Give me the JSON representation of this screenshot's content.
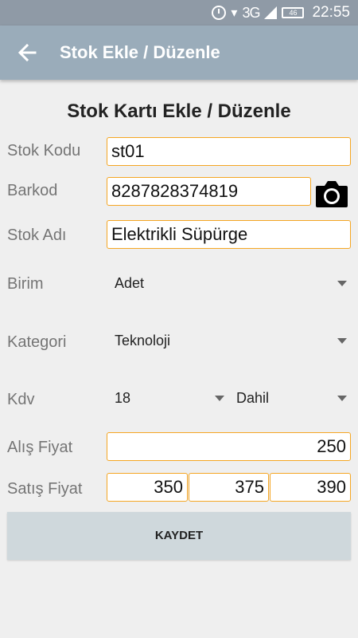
{
  "status_bar": {
    "network": "3G",
    "battery": "46",
    "time": "22:55"
  },
  "app_bar": {
    "title": "Stok Ekle / Düzenle"
  },
  "form": {
    "title": "Stok Kartı Ekle / Düzenle",
    "stok_kodu": {
      "label": "Stok Kodu",
      "value": "st01"
    },
    "barkod": {
      "label": "Barkod",
      "value": "8287828374819"
    },
    "stok_adi": {
      "label": "Stok Adı",
      "value": "Elektrikli Süpürge"
    },
    "birim": {
      "label": "Birim",
      "value": "Adet"
    },
    "kategori": {
      "label": "Kategori",
      "value": "Teknoloji"
    },
    "kdv": {
      "label": "Kdv",
      "rate": "18",
      "mode": "Dahil"
    },
    "alis_fiyat": {
      "label": "Alış Fiyat",
      "value": "250"
    },
    "satis_fiyat": {
      "label": "Satış Fiyat",
      "values": [
        "350",
        "375",
        "390"
      ]
    },
    "save_label": "KAYDET"
  },
  "icons": {
    "back": "arrow-left-icon",
    "camera": "camera-icon",
    "alarm": "alarm-clock-icon",
    "wifi": "wifi-icon",
    "signal": "cell-signal-icon",
    "battery": "battery-icon"
  },
  "colors": {
    "app_bar": "#9aacba",
    "status_bar": "#8f9aa6",
    "field_border": "#f5a623",
    "button_bg": "#cfd8dc"
  }
}
